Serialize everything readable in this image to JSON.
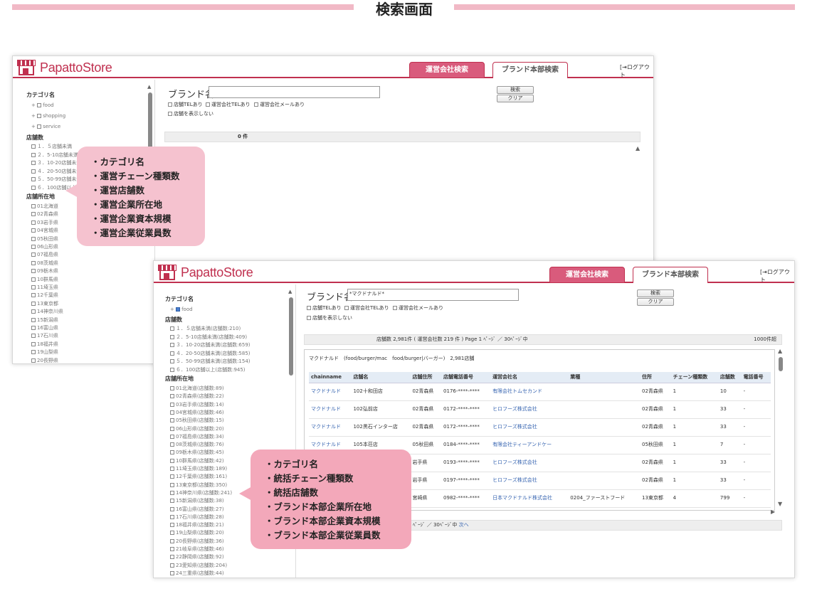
{
  "page_heading": "検索画面",
  "app": {
    "logo_text": "PapattoStore",
    "tab_active": "運営会社検索",
    "tab_inactive": "ブランド本部検索",
    "logout": "ログアウト",
    "colors": {
      "brand": "#c0304f",
      "tab_active_bg": "#d95b7c",
      "bubble_a": "#f5c2cf",
      "bubble_b": "#f3a8ba"
    }
  },
  "window_a": {
    "sidebar": {
      "category_head": "カテゴリ名",
      "categories": [
        "food",
        "shopping",
        "service"
      ],
      "store_count_head": "店舗数",
      "store_counts": [
        "１．５店舗未満",
        "２．5-10店舗未満",
        "３．10-20店舗未満",
        "４．20-50店舗未満",
        "５．50-99店舗未満",
        "６．100店舗以上"
      ],
      "location_head": "店舗所在地",
      "locations": [
        "01北海道",
        "02青森県",
        "03岩手県",
        "04宮城県",
        "05秋田県",
        "06山形県",
        "07福島県",
        "08茨城県",
        "09栃木県",
        "10群馬県",
        "11埼玉県",
        "12千葉県",
        "13東京都",
        "14神奈川県",
        "15新潟県",
        "16富山県",
        "17石川県",
        "18福井県",
        "19山梨県",
        "20長野県"
      ]
    },
    "search": {
      "brand_label": "ブランド名",
      "brand_value": "",
      "options": [
        "店舗TELあり",
        "運営会社TELあり",
        "運営会社メールあり"
      ],
      "hide_option": "店舗を表示しない",
      "search_button": "検索",
      "clear_button": "クリア",
      "count_text": "0 件"
    }
  },
  "window_b": {
    "sidebar": {
      "category_head": "カテゴリ名",
      "category_selected": "food",
      "store_count_head": "店舗数",
      "store_counts": [
        "１．５店舗未満(店舗数:210)",
        "２．5-10店舗未満(店舗数:409)",
        "３．10-20店舗未満(店舗数:659)",
        "４．20-50店舗未満(店舗数:585)",
        "５．50-99店舗未満(店舗数:154)",
        "６．100店舗以上(店舗数:945)"
      ],
      "location_head": "店舗所在地",
      "locations": [
        "01北海道(店舗数:89)",
        "02青森県(店舗数:22)",
        "03岩手県(店舗数:14)",
        "04宮城県(店舗数:46)",
        "05秋田県(店舗数:15)",
        "06山形県(店舗数:20)",
        "07福島県(店舗数:34)",
        "08茨城県(店舗数:76)",
        "09栃木県(店舗数:45)",
        "10群馬県(店舗数:42)",
        "11埼玉県(店舗数:189)",
        "12千葉県(店舗数:161)",
        "13東京都(店舗数:350)",
        "14神奈川県(店舗数:241)",
        "15新潟県(店舗数:38)",
        "16富山県(店舗数:27)",
        "17石川県(店舗数:28)",
        "18福井県(店舗数:21)",
        "19山梨県(店舗数:20)",
        "20長野県(店舗数:36)",
        "21岐阜県(店舗数:46)",
        "22静岡県(店舗数:92)",
        "23愛知県(店舗数:204)",
        "24三重県(店舗数:44)"
      ]
    },
    "search": {
      "brand_label": "ブランド名",
      "brand_value": "*マクドナルド*",
      "options": [
        "店舗TELあり",
        "運営会社TELあり",
        "運営会社メールあり"
      ],
      "hide_option": "店舗を表示しない",
      "search_button": "検索",
      "clear_button": "クリア",
      "summary": "店舗数 2,981件 ( 運営会社数 219 件 ) Page 1 ﾍﾟｰｼﾞ ／ 30ﾍﾟｰｼﾞ中",
      "limit": "1000件超",
      "pager_bottom": "ﾍﾟｰｼﾞ ／ 30ﾍﾟｰｼﾞ中",
      "next": "次へ"
    },
    "result": {
      "title": "マクドナルド　(food/burger/mac　food/burger|バーガー)　2,981店舗",
      "columns": [
        "chainname",
        "店舗名",
        "店舗住所",
        "店舗電話番号",
        "運営会社名",
        "業種",
        "住所",
        "チェーン種類数",
        "店舗数",
        "電話番号"
      ],
      "rows": [
        [
          "マクドナルド",
          "102十和田店",
          "02青森県",
          "0176-****-****",
          "有限会社トムセカンド",
          "",
          "02青森県",
          "1",
          "10",
          "-"
        ],
        [
          "マクドナルド",
          "102弘前店",
          "02青森県",
          "0172-****-****",
          "ヒロフーズ株式会社",
          "",
          "02青森県",
          "1",
          "33",
          "-"
        ],
        [
          "マクドナルド",
          "102黒石インター店",
          "02青森県",
          "0172-****-****",
          "ヒロフーズ株式会社",
          "",
          "02青森県",
          "1",
          "33",
          "-"
        ],
        [
          "マクドナルド",
          "105本荘店",
          "05秋田県",
          "0184-****-****",
          "有限会社ティーアンドケー",
          "",
          "05秋田県",
          "1",
          "7",
          "-"
        ],
        [
          "",
          "",
          "岩手県",
          "0193-****-****",
          "ヒロフーズ株式会社",
          "",
          "02青森県",
          "1",
          "33",
          "-"
        ],
        [
          "",
          "",
          "岩手県",
          "0197-****-****",
          "ヒロフーズ株式会社",
          "",
          "02青森県",
          "1",
          "33",
          "-"
        ],
        [
          "",
          "",
          "宮崎県",
          "0982-****-****",
          "日本マクドナルド株式会社",
          "0204_ファーストフード",
          "13東京都",
          "4",
          "799",
          "-"
        ]
      ]
    }
  },
  "bubble_a": [
    "・カテゴリ名",
    "・運営チェーン種類数",
    "・運営店舗数",
    "・運営企業所在地",
    "・運営企業資本規模",
    "・運営企業従業員数"
  ],
  "bubble_b": [
    "・カテゴリ名",
    "・統括チェーン種類数",
    "・統括店舗数",
    "・ブランド本部企業所在地",
    "・ブランド本部企業資本規模",
    "・ブランド本部企業従業員数"
  ]
}
